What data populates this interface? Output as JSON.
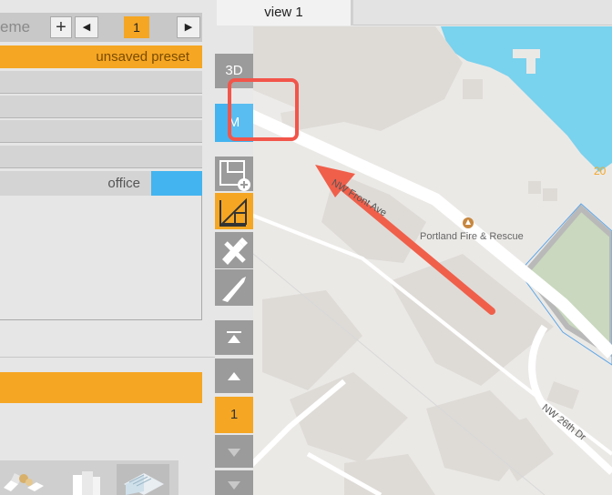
{
  "left_panel": {
    "scheme_label": "eme",
    "add_symbol": "+",
    "prev_symbol": "◀",
    "page_number": "1",
    "next_symbol": "▶",
    "preset_label": "unsaved preset",
    "office_label": "office"
  },
  "toolbar": {
    "btn_3d": "3D",
    "btn_m": "M",
    "page_number": "1"
  },
  "tabs": [
    {
      "label": "view 1"
    }
  ],
  "map": {
    "street_front": "NW Front Ave",
    "street_26th": "NW 26th Dr",
    "poi": "Portland Fire & Rescue",
    "building_number": "20"
  },
  "colors": {
    "orange": "#f5a623",
    "blue": "#43b4f0",
    "highlight": "#f2554a"
  }
}
